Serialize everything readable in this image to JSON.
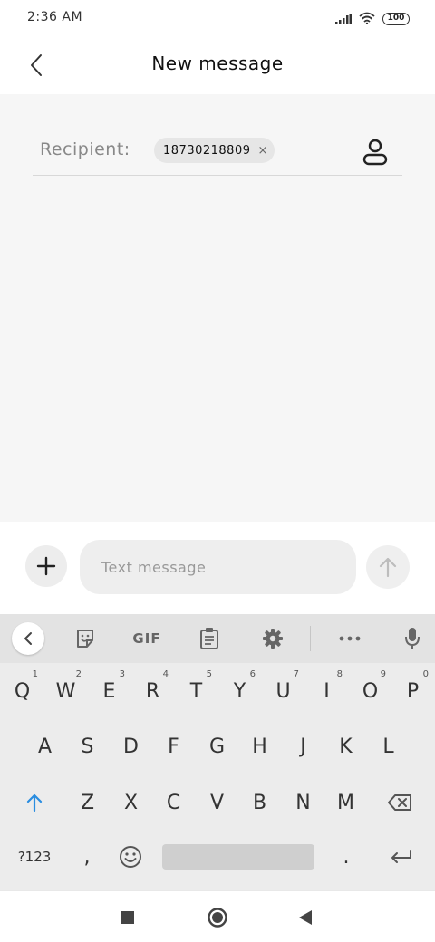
{
  "status_bar": {
    "time": "2:36 AM",
    "battery": "100",
    "icons": [
      "signal-icon",
      "wifi-icon",
      "battery-icon"
    ]
  },
  "header": {
    "title": "New message",
    "back_icon": "chevron-left-icon"
  },
  "recipient": {
    "label": "Recipient:",
    "chip_number": "18730218809",
    "chip_remove": "×",
    "contact_icon": "person-icon"
  },
  "compose": {
    "placeholder": "Text message",
    "add_icon": "plus-icon",
    "send_icon": "arrow-up-icon"
  },
  "keyboard": {
    "toolbar": {
      "collapse_icon": "chevron-left-icon",
      "sticker_icon": "sticker-icon",
      "gif_label": "GIF",
      "clipboard_icon": "clipboard-icon",
      "settings_icon": "gear-icon",
      "more_icon": "more-dots-icon",
      "mic_icon": "microphone-icon"
    },
    "row1": [
      {
        "key": "Q",
        "hint": "1"
      },
      {
        "key": "W",
        "hint": "2"
      },
      {
        "key": "E",
        "hint": "3"
      },
      {
        "key": "R",
        "hint": "4"
      },
      {
        "key": "T",
        "hint": "5"
      },
      {
        "key": "Y",
        "hint": "6"
      },
      {
        "key": "U",
        "hint": "7"
      },
      {
        "key": "I",
        "hint": "8"
      },
      {
        "key": "O",
        "hint": "9"
      },
      {
        "key": "P",
        "hint": "0"
      }
    ],
    "row2": [
      "A",
      "S",
      "D",
      "F",
      "G",
      "H",
      "J",
      "K",
      "L"
    ],
    "row3": [
      "Z",
      "X",
      "C",
      "V",
      "B",
      "N",
      "M"
    ],
    "symbols_key": "?123",
    "comma_key": ",",
    "period_key": ".",
    "accent_color": "#2a8de0"
  },
  "nav_bar": {
    "icons": [
      "recents-square-icon",
      "home-circle-icon",
      "back-triangle-icon"
    ]
  }
}
